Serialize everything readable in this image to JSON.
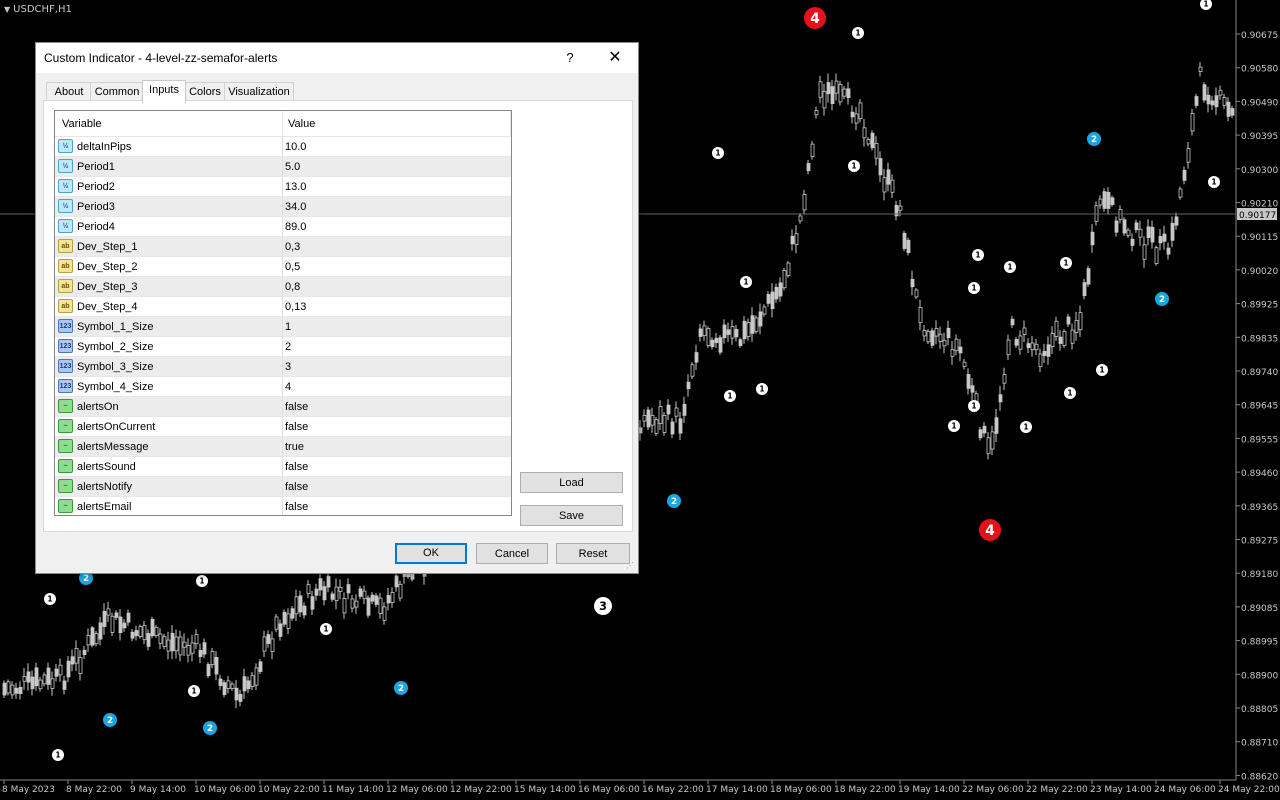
{
  "chart": {
    "symbol": "USDCHF,H1",
    "price_labels": [
      "0.90675",
      "0.90580",
      "0.90490",
      "0.90395",
      "0.90300",
      "0.90210",
      "0.90115",
      "0.90020",
      "0.89925",
      "0.89835",
      "0.89740",
      "0.89645",
      "0.89555",
      "0.89460",
      "0.89365",
      "0.89275",
      "0.89180",
      "0.89085",
      "0.88995",
      "0.88900",
      "0.88805",
      "0.88710",
      "0.88620"
    ],
    "current_price": "0.90177",
    "time_labels": [
      "8 May 2023",
      "8 May 22:00",
      "9 May 14:00",
      "10 May 06:00",
      "10 May 22:00",
      "11 May 14:00",
      "12 May 06:00",
      "12 May 22:00",
      "15 May 14:00",
      "16 May 06:00",
      "16 May 22:00",
      "17 May 14:00",
      "18 May 06:00",
      "18 May 22:00",
      "19 May 14:00",
      "22 May 06:00",
      "22 May 22:00",
      "23 May 14:00",
      "24 May 06:00",
      "24 May 22:00"
    ],
    "colors": {
      "background": "#000000",
      "candle": "#c8c8c8",
      "level1": "#ffffff",
      "level2": "#1aa6e0",
      "level3": "#ffffff",
      "level4": "#e0100f",
      "axis_text": "#c8c8c8"
    },
    "signals": [
      {
        "level": "4",
        "color": "#e8101a"
      },
      {
        "level": "4",
        "color": "#e8101a"
      },
      {
        "level": "3",
        "color": "#ffffff"
      },
      {
        "level": "2",
        "color": "#1aa6e0"
      },
      {
        "level": "1",
        "color": "#ffffff"
      }
    ]
  },
  "dialog": {
    "title": "Custom Indicator - 4-level-zz-semafor-alerts",
    "help_label": "?",
    "close_label": "✕",
    "tabs": [
      "About",
      "Common",
      "Inputs",
      "Colors",
      "Visualization"
    ],
    "active_tab": "Inputs",
    "table": {
      "headers": [
        "Variable",
        "Value"
      ],
      "rows": [
        {
          "type": "double",
          "icon": "½",
          "name": "deltaInPips",
          "value": "10.0"
        },
        {
          "type": "double",
          "icon": "½",
          "name": "Period1",
          "value": "5.0"
        },
        {
          "type": "double",
          "icon": "½",
          "name": "Period2",
          "value": "13.0"
        },
        {
          "type": "double",
          "icon": "½",
          "name": "Period3",
          "value": "34.0"
        },
        {
          "type": "double",
          "icon": "½",
          "name": "Period4",
          "value": "89.0"
        },
        {
          "type": "string",
          "icon": "ab",
          "name": "Dev_Step_1",
          "value": "0,3"
        },
        {
          "type": "string",
          "icon": "ab",
          "name": "Dev_Step_2",
          "value": "0,5"
        },
        {
          "type": "string",
          "icon": "ab",
          "name": "Dev_Step_3",
          "value": "0,8"
        },
        {
          "type": "string",
          "icon": "ab",
          "name": "Dev_Step_4",
          "value": "0,13"
        },
        {
          "type": "int",
          "icon": "123",
          "name": "Symbol_1_Size",
          "value": "1"
        },
        {
          "type": "int",
          "icon": "123",
          "name": "Symbol_2_Size",
          "value": "2"
        },
        {
          "type": "int",
          "icon": "123",
          "name": "Symbol_3_Size",
          "value": "3"
        },
        {
          "type": "int",
          "icon": "123",
          "name": "Symbol_4_Size",
          "value": "4"
        },
        {
          "type": "bool",
          "icon": "~",
          "name": "alertsOn",
          "value": "false"
        },
        {
          "type": "bool",
          "icon": "~",
          "name": "alertsOnCurrent",
          "value": "false"
        },
        {
          "type": "bool",
          "icon": "~",
          "name": "alertsMessage",
          "value": "true"
        },
        {
          "type": "bool",
          "icon": "~",
          "name": "alertsSound",
          "value": "false"
        },
        {
          "type": "bool",
          "icon": "~",
          "name": "alertsNotify",
          "value": "false"
        },
        {
          "type": "bool",
          "icon": "~",
          "name": "alertsEmail",
          "value": "false"
        }
      ]
    },
    "buttons": {
      "load": "Load",
      "save": "Save",
      "ok": "OK",
      "cancel": "Cancel",
      "reset": "Reset"
    }
  }
}
